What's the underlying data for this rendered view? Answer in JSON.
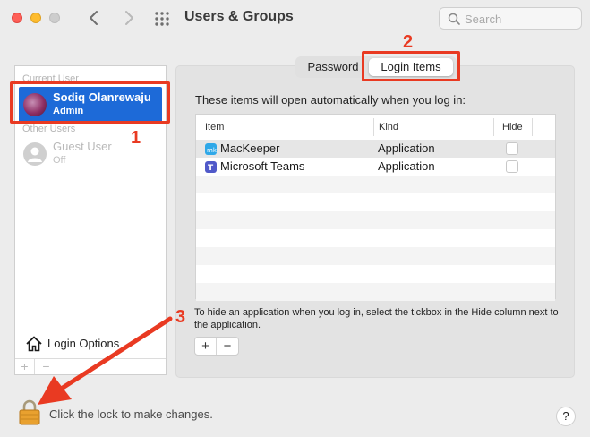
{
  "window": {
    "title": "Users & Groups"
  },
  "toolbar": {
    "search_placeholder": "Search"
  },
  "users": {
    "current_section": "Current User",
    "current_user": {
      "name": "Sodiq Olanrewaju",
      "role": "Admin"
    },
    "other_section": "Other Users",
    "guest_user": {
      "name": "Guest User",
      "role": "Off"
    },
    "login_options": "Login Options",
    "add_label": "+",
    "remove_label": "−"
  },
  "tabs": {
    "password": "Password",
    "login_items": "Login Items",
    "selected": "Login Items"
  },
  "login_items": {
    "description": "These items will open automatically when you log in:",
    "columns": {
      "item": "Item",
      "kind": "Kind",
      "hide": "Hide"
    },
    "rows": [
      {
        "name": "MacKeeper",
        "kind": "Application",
        "hidden": false,
        "icon": "mackeeper-icon"
      },
      {
        "name": "Microsoft Teams",
        "kind": "Application",
        "hidden": false,
        "icon": "teams-icon"
      }
    ],
    "hint": "To hide an application when you log in, select the tickbox in the Hide column next to the application.",
    "add_label": "+",
    "remove_label": "−"
  },
  "footer": {
    "lock_text": "Click the lock to make changes.",
    "help_label": "?"
  },
  "annotations": {
    "step1": "1",
    "step2": "2",
    "step3": "3",
    "color": "#e93a22"
  },
  "colors": {
    "selection": "#1d6ad8",
    "window_bg": "#ececec"
  }
}
